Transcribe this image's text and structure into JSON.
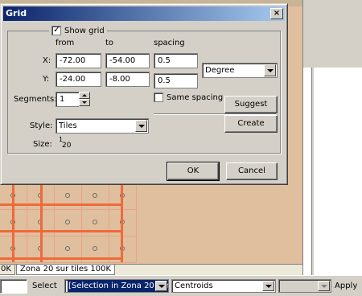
{
  "dialog": {
    "title": "Grid",
    "close_glyph": "×",
    "show_grid_label": "Show grid",
    "show_grid_checked": true,
    "col_from": "from",
    "col_to": "to",
    "col_spacing": "spacing",
    "x_label": "X:",
    "x_from": "-72.00",
    "x_to": "-54.00",
    "x_spacing": "0.5",
    "y_label": "Y:",
    "y_from": "-24.00",
    "y_to": "-8.00",
    "y_spacing": "0.5",
    "unit_value": "Degree",
    "segments_label": "Segments:",
    "segments_value": "1",
    "same_spacing_label": "Same spacing",
    "same_spacing_checked": false,
    "suggest_label": "Suggest",
    "create_label": "Create",
    "style_label": "Style:",
    "style_value": "Tiles",
    "size_label": "Size:",
    "size_num": "1",
    "size_den": "20",
    "ok_label": "OK",
    "cancel_label": "Cancel"
  },
  "tabs": {
    "partial_tab": "0K",
    "active_tab": "Zona 20 sur tiles 100K"
  },
  "statusbar": {
    "select_label": "Select",
    "selection_value": "[Selection in Zona 20 sur",
    "centroids_value": "Centroids",
    "apply_label": "Apply"
  },
  "colors": {
    "map_bg": "#dfbf9d",
    "grid_line": "#ef6a3a",
    "title_gradient_start": "#0a246a",
    "title_gradient_end": "#a6caf0"
  }
}
